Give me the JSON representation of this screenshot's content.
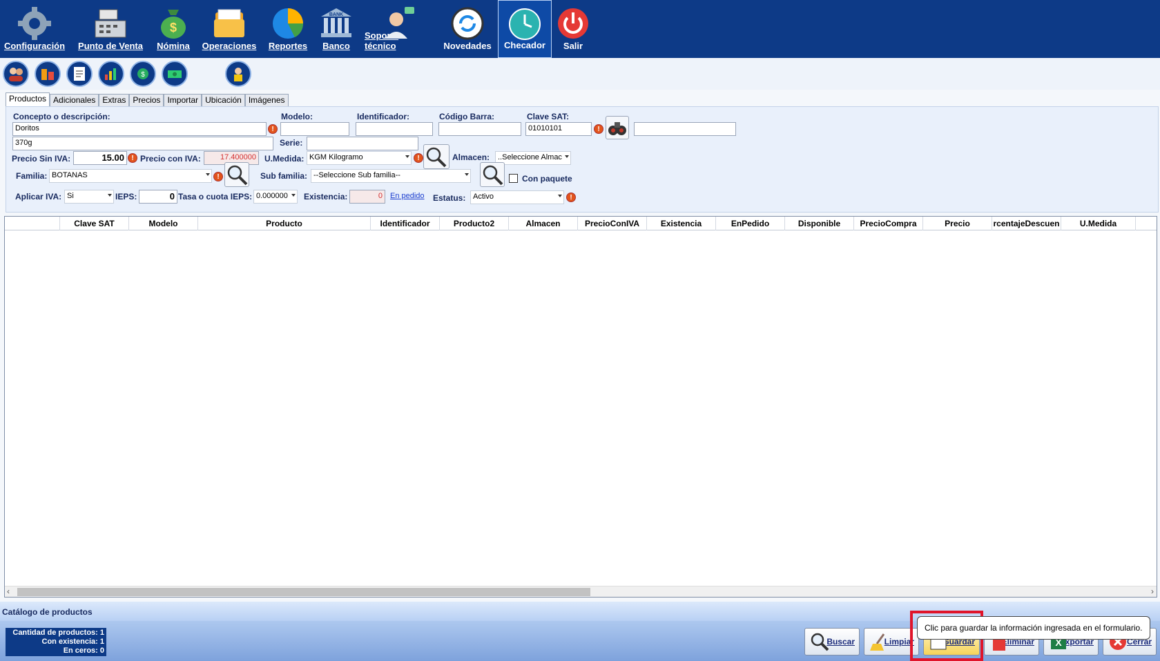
{
  "toolbar": {
    "items": [
      {
        "label": "Configuración",
        "icon": "gear-icon"
      },
      {
        "label": "Punto de Venta",
        "icon": "cash-register-icon"
      },
      {
        "label": "Nómina",
        "icon": "money-bag-icon"
      },
      {
        "label": "Operaciones",
        "icon": "folder-icon"
      },
      {
        "label": "Reportes",
        "icon": "pie-chart-icon"
      },
      {
        "label": "Banco",
        "icon": "bank-icon"
      },
      {
        "label": "Soporte técnico",
        "icon": "support-agent-icon"
      },
      {
        "label": "Novedades",
        "icon": "refresh-icon"
      },
      {
        "label": "Checador",
        "icon": "clock-icon"
      },
      {
        "label": "Salir",
        "icon": "power-icon"
      }
    ],
    "bank_sign": "BANK"
  },
  "tabs": [
    "Productos",
    "Adicionales",
    "Extras",
    "Precios",
    "Importar",
    "Ubicación",
    "Imágenes"
  ],
  "form": {
    "concepto_label": "Concepto o descripción:",
    "concepto_value": "Doritos",
    "concepto2_value": "370g",
    "modelo_label": "Modelo:",
    "modelo_value": "",
    "serie_label": "Serie:",
    "serie_value": "",
    "identificador_label": "Identificador:",
    "identificador_value": "",
    "codigo_barra_label": "Código Barra:",
    "codigo_barra_value": "",
    "clave_sat_label": "Clave SAT:",
    "clave_sat_value": "01010101",
    "clave_sat_desc_value": "",
    "precio_sin_iva_label": "Precio Sin IVA:",
    "precio_sin_iva_value": "15.00",
    "precio_con_iva_label": "Precio con IVA:",
    "precio_con_iva_value": "17.400000",
    "umedida_label": "U.Medida:",
    "umedida_value": "KGM Kilogramo",
    "almacen_label": "Almacen:",
    "almacen_value": "..Seleccione Almac",
    "familia_label": "Familia:",
    "familia_value": "BOTANAS",
    "subfamilia_label": "Sub familia:",
    "subfamilia_value": "--Seleccione Sub familia--",
    "con_paquete_label": "Con paquete",
    "aplicar_iva_label": "Aplicar IVA:",
    "aplicar_iva_value": "Si",
    "ieps_label": "IEPS:",
    "ieps_value": "0",
    "tasa_ieps_label": "Tasa o cuota IEPS:",
    "tasa_ieps_value": "0.000000",
    "existencia_label": "Existencia:",
    "existencia_value": "0",
    "en_pedido_link": "En pedido",
    "estatus_label": "Estatus:",
    "estatus_value": "Activo",
    "warn_glyph": "!"
  },
  "grid": {
    "columns": [
      "",
      "Clave SAT",
      "Modelo",
      "Producto",
      "Identificador",
      "Producto2",
      "Almacen",
      "PrecioConIVA",
      "Existencia",
      "EnPedido",
      "Disponible",
      "PrecioCompra",
      "Precio",
      "rcentajeDescuen",
      "U.Medida"
    ],
    "scroll_left": "‹",
    "scroll_right": "›"
  },
  "footer": {
    "title": "Catálogo de productos",
    "stats": [
      "Cantidad de productos: 1",
      "Con existencia: 1",
      "En ceros: 0"
    ]
  },
  "buttons": {
    "buscar": "Buscar",
    "limpiar": "Limpiar",
    "guardar": "Guardar",
    "eliminar": "Eliminar",
    "exportar": "Exportar",
    "cerrar": "Cerrar"
  },
  "tooltip": "Clic para guardar la información ingresada en el formulario."
}
